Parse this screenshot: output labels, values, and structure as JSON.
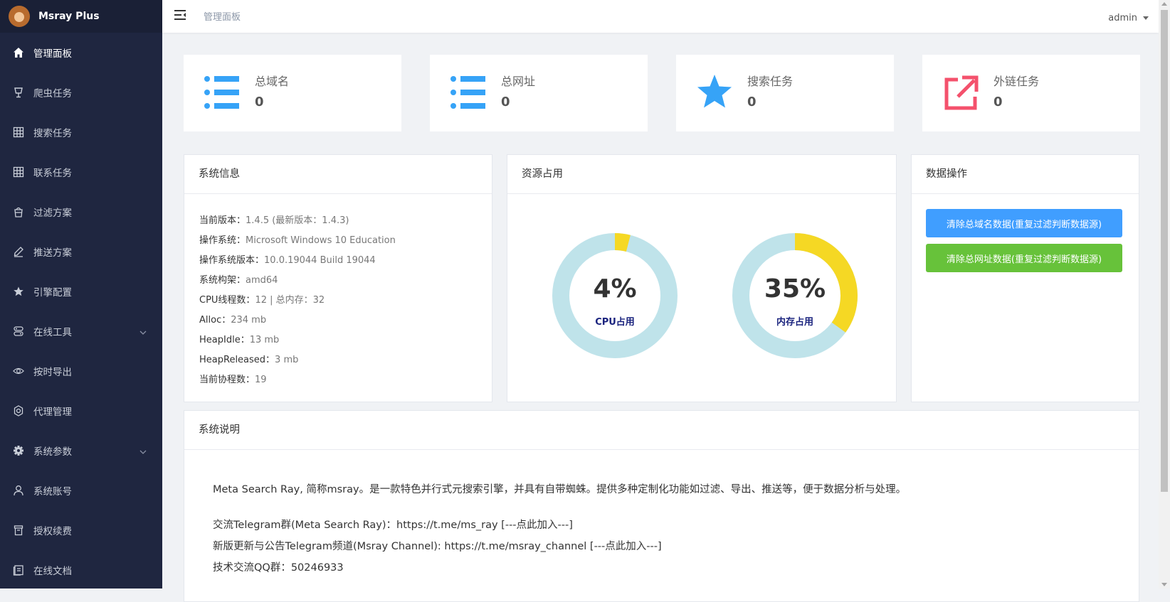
{
  "brand": {
    "name": "Msray Plus"
  },
  "sidebar": {
    "items": [
      {
        "label": "管理面板",
        "icon": "home-icon"
      },
      {
        "label": "爬虫任务",
        "icon": "lamp-icon"
      },
      {
        "label": "搜索任务",
        "icon": "grid-icon"
      },
      {
        "label": "联系任务",
        "icon": "grid-icon"
      },
      {
        "label": "过滤方案",
        "icon": "bucket-icon"
      },
      {
        "label": "推送方案",
        "icon": "pen-icon"
      },
      {
        "label": "引擎配置",
        "icon": "star-icon"
      },
      {
        "label": "在线工具",
        "icon": "tools-icon"
      },
      {
        "label": "按时导出",
        "icon": "eye-icon"
      },
      {
        "label": "代理管理",
        "icon": "gear-outline-icon"
      },
      {
        "label": "系统参数",
        "icon": "gear-icon"
      },
      {
        "label": "系统账号",
        "icon": "user-icon"
      },
      {
        "label": "授权续费",
        "icon": "trash-icon"
      },
      {
        "label": "在线文档",
        "icon": "doc-icon"
      }
    ]
  },
  "header": {
    "breadcrumb": "管理面板",
    "user": "admin"
  },
  "stats": [
    {
      "title": "总域名",
      "value": "0",
      "icon": "list-icon",
      "color": "#36a3f7"
    },
    {
      "title": "总网址",
      "value": "0",
      "icon": "list-icon",
      "color": "#36a3f7"
    },
    {
      "title": "搜索任务",
      "value": "0",
      "icon": "star-icon",
      "color": "#36a3f7"
    },
    {
      "title": "外链任务",
      "value": "0",
      "icon": "external-link-icon",
      "color": "#f4516c"
    }
  ],
  "system_info": {
    "title": "系统信息",
    "rows": [
      {
        "label": "当前版本：",
        "value": "1.4.5 (最新版本：1.4.3)"
      },
      {
        "label": "操作系统：",
        "value": "Microsoft Windows 10 Education"
      },
      {
        "label": "操作系统版本：",
        "value": "10.0.19044 Build 19044"
      },
      {
        "label": "系统构架：",
        "value": "amd64"
      },
      {
        "label": "CPU线程数：",
        "value": "12 | 总内存：32"
      },
      {
        "label": "Alloc：",
        "value": "234 mb"
      },
      {
        "label": "HeapIdle：",
        "value": "13 mb"
      },
      {
        "label": "HeapReleased：",
        "value": "3 mb"
      },
      {
        "label": "当前协程数：",
        "value": "19"
      }
    ]
  },
  "resources": {
    "title": "资源占用",
    "cpu": {
      "label": "CPU占用",
      "display": "4%",
      "value": 0.04
    },
    "mem": {
      "label": "内存占用",
      "display": "35%",
      "value": 0.35
    },
    "track_color": "#bfe3ea",
    "fill_color": "#f5d824"
  },
  "data_ops": {
    "title": "数据操作",
    "clear_domain_label": "清除总域名数据(重复过滤判断数据源)",
    "clear_url_label": "清除总网址数据(重复过滤判断数据源)"
  },
  "system_desc": {
    "title": "系统说明",
    "intro": "Meta Search Ray, 简称msray。是一款特色并行式元搜索引擎，并具有自带蜘蛛。提供多种定制化功能如过滤、导出、推送等，便于数据分析与处理。",
    "telegram_group": "交流Telegram群(Meta Search Ray)：https://t.me/ms_ray [---点此加入---]",
    "telegram_channel": "新版更新与公告Telegram频道(Msray Channel): https://t.me/msray_channel [---点此加入---]",
    "qq_group": "技术交流QQ群：50246933"
  }
}
